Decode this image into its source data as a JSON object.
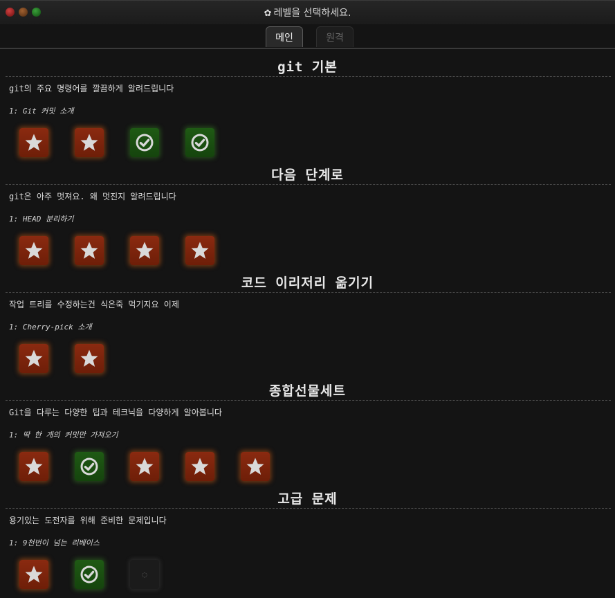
{
  "window": {
    "title": "레벨을 선택하세요.",
    "title_icon": "gear-icon"
  },
  "tabs": [
    {
      "label": "메인",
      "active": true
    },
    {
      "label": "원격",
      "active": false
    }
  ],
  "colors": {
    "background": "#141414",
    "star_box": "#7a2410",
    "done_box": "#1f5a14",
    "text": "#e6e6e6"
  },
  "sections": [
    {
      "title": "git 기본",
      "description": "git의 주요 명령어를 깔끔하게 알려드립니다",
      "level_label": "1: Git 커밋 소개",
      "levels": [
        "star",
        "star",
        "done",
        "done"
      ]
    },
    {
      "title": "다음 단계로",
      "description": "git은 아주 멋져요. 왜 멋진지 알려드립니다",
      "level_label": "1: HEAD 분리하기",
      "levels": [
        "star",
        "star",
        "star",
        "star"
      ]
    },
    {
      "title": "코드 이리저리 옮기기",
      "description": "작업 트리를 수정하는건 식은죽 먹기지요 이제",
      "level_label": "1: Cherry-pick 소개",
      "levels": [
        "star",
        "star"
      ]
    },
    {
      "title": "종합선물세트",
      "description": "Git을 다루는 다양한 팁과 테크닉을 다양하게 알아봅니다",
      "level_label": "1: 딱 한 개의 커밋만 가져오기",
      "levels": [
        "star",
        "done",
        "star",
        "star",
        "star"
      ]
    },
    {
      "title": "고급 문제",
      "description": "용기있는 도전자를 위해 준비한 문제입니다",
      "level_label": "1: 9천번이 넘는 리베이스",
      "levels": [
        "star",
        "done",
        "locked"
      ]
    }
  ]
}
